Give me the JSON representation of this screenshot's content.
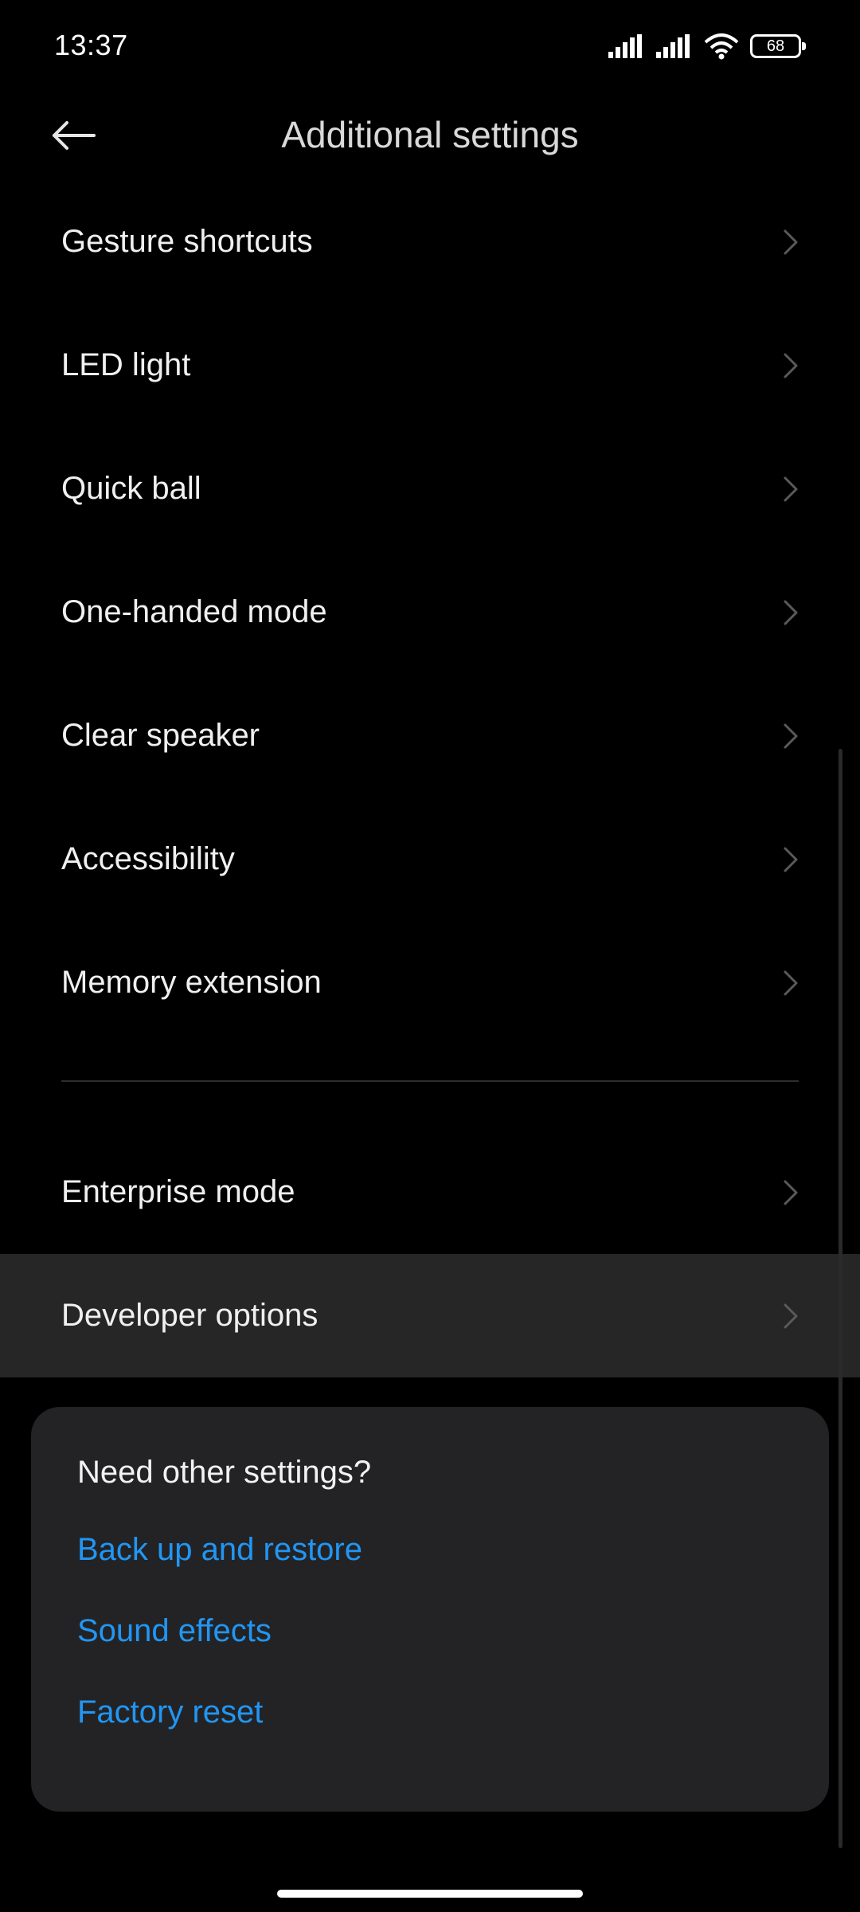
{
  "status_bar": {
    "time": "13:37",
    "battery_level": "68",
    "icons": [
      "signal-icon",
      "signal-icon",
      "wifi-icon",
      "battery-icon"
    ]
  },
  "header": {
    "title": "Additional settings",
    "back_icon": "arrow-left-icon"
  },
  "settings": {
    "items": [
      {
        "label": "Gesture shortcuts"
      },
      {
        "label": "LED light"
      },
      {
        "label": "Quick ball"
      },
      {
        "label": "One-handed mode"
      },
      {
        "label": "Clear speaker"
      },
      {
        "label": "Accessibility"
      },
      {
        "label": "Memory extension"
      }
    ],
    "items_group2": [
      {
        "label": "Enterprise mode"
      },
      {
        "label": "Developer options"
      }
    ]
  },
  "suggestions": {
    "title": "Need other settings?",
    "links": [
      {
        "label": "Back up and restore"
      },
      {
        "label": "Sound effects"
      },
      {
        "label": "Factory reset"
      }
    ]
  },
  "colors": {
    "background": "#000000",
    "highlight_row": "#262626",
    "card": "#232325",
    "link": "#2196f3"
  }
}
